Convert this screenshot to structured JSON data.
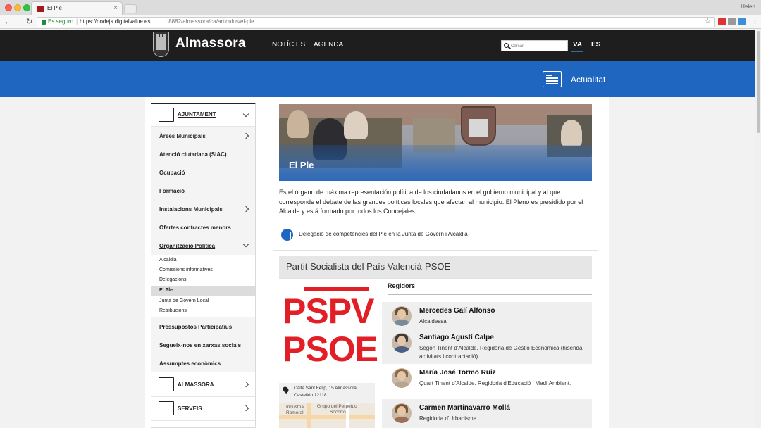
{
  "browser": {
    "tab_title": "El Ple",
    "user": "Helen",
    "secure_label": "Es seguro",
    "url_host": "https://nodejs.digitalvalue.es",
    "url_path": ":8882/almassora/ca/articulos/el-ple"
  },
  "header": {
    "brand": "Almassora",
    "nav": [
      "NOTÍCIES",
      "AGENDA"
    ],
    "search_placeholder": "Cercar",
    "languages": [
      "VA",
      "ES"
    ],
    "active_language": "VA"
  },
  "banner": {
    "title": "Actualitat"
  },
  "sidebar": {
    "ajuntament": "AJUNTAMENT",
    "items_top": [
      "Àrees Municipals",
      "Atenció ciutadana (SIAC)",
      "Ocupació",
      "Formació",
      "Instalacions Municipals",
      "Ofertes contractes menors",
      "Organització Política"
    ],
    "subitems": [
      "Alcaldia",
      "Comissions informatives",
      "Delegacions",
      "El Ple",
      "Junta de Govern Local",
      "Retribucions"
    ],
    "active_subitem": "El Ple",
    "items_bottom": [
      "Pressupostos Participatius",
      "Segueix-nos en xarxas socials",
      "Assumptes econòmics"
    ],
    "section_almassora": "ALMASSORA",
    "section_serveis": "SERVEIS"
  },
  "main": {
    "hero_title": "El Ple",
    "intro": "Es el órgano de máxima representación política de los ciudadanos en el gobierno municipal y al que corresponde el debate de las grandes políticas locales que afectan al municipio. El Pleno es presidido por el Alcalde y está formado por todos los Concejales.",
    "doc_link": "Delegació de competències del Ple en la Junta de Govern i Alcaldia",
    "party": {
      "title": "Partit Socialista del País Valencià-PSOE",
      "logo_line1": "PSPV",
      "logo_line2": "PSOE",
      "address_line1": "Calle Sant Felip, 15 Almassora",
      "address_line2": "Castellón 12118",
      "map_label1": "Industrial",
      "map_label2": "Romeral",
      "map_label3": "Grupo del Perpetuo",
      "map_label4": "Socorro",
      "regidors_title": "Regidors",
      "members": [
        {
          "name": "Mercedes Galí Alfonso",
          "role": "Alcaldessa"
        },
        {
          "name": "Santiago Agustí Calpe",
          "role": "Segon Tinent d'Alcalde. Regidoria de Gestió Econòmica (hisenda, activitats i contractació)."
        },
        {
          "name": "María José Tormo Ruiz",
          "role": "Quart Tinent d'Alcalde. Regidoria d'Educació i Medi Ambient."
        },
        {
          "name": "Carmen Martinavarro Mollá",
          "role": "Regidoria d'Urbanisme."
        }
      ]
    }
  },
  "colors": {
    "brand_blue": "#1f66c1",
    "topbar": "#1e1e1e",
    "party_red": "#e21f26"
  }
}
